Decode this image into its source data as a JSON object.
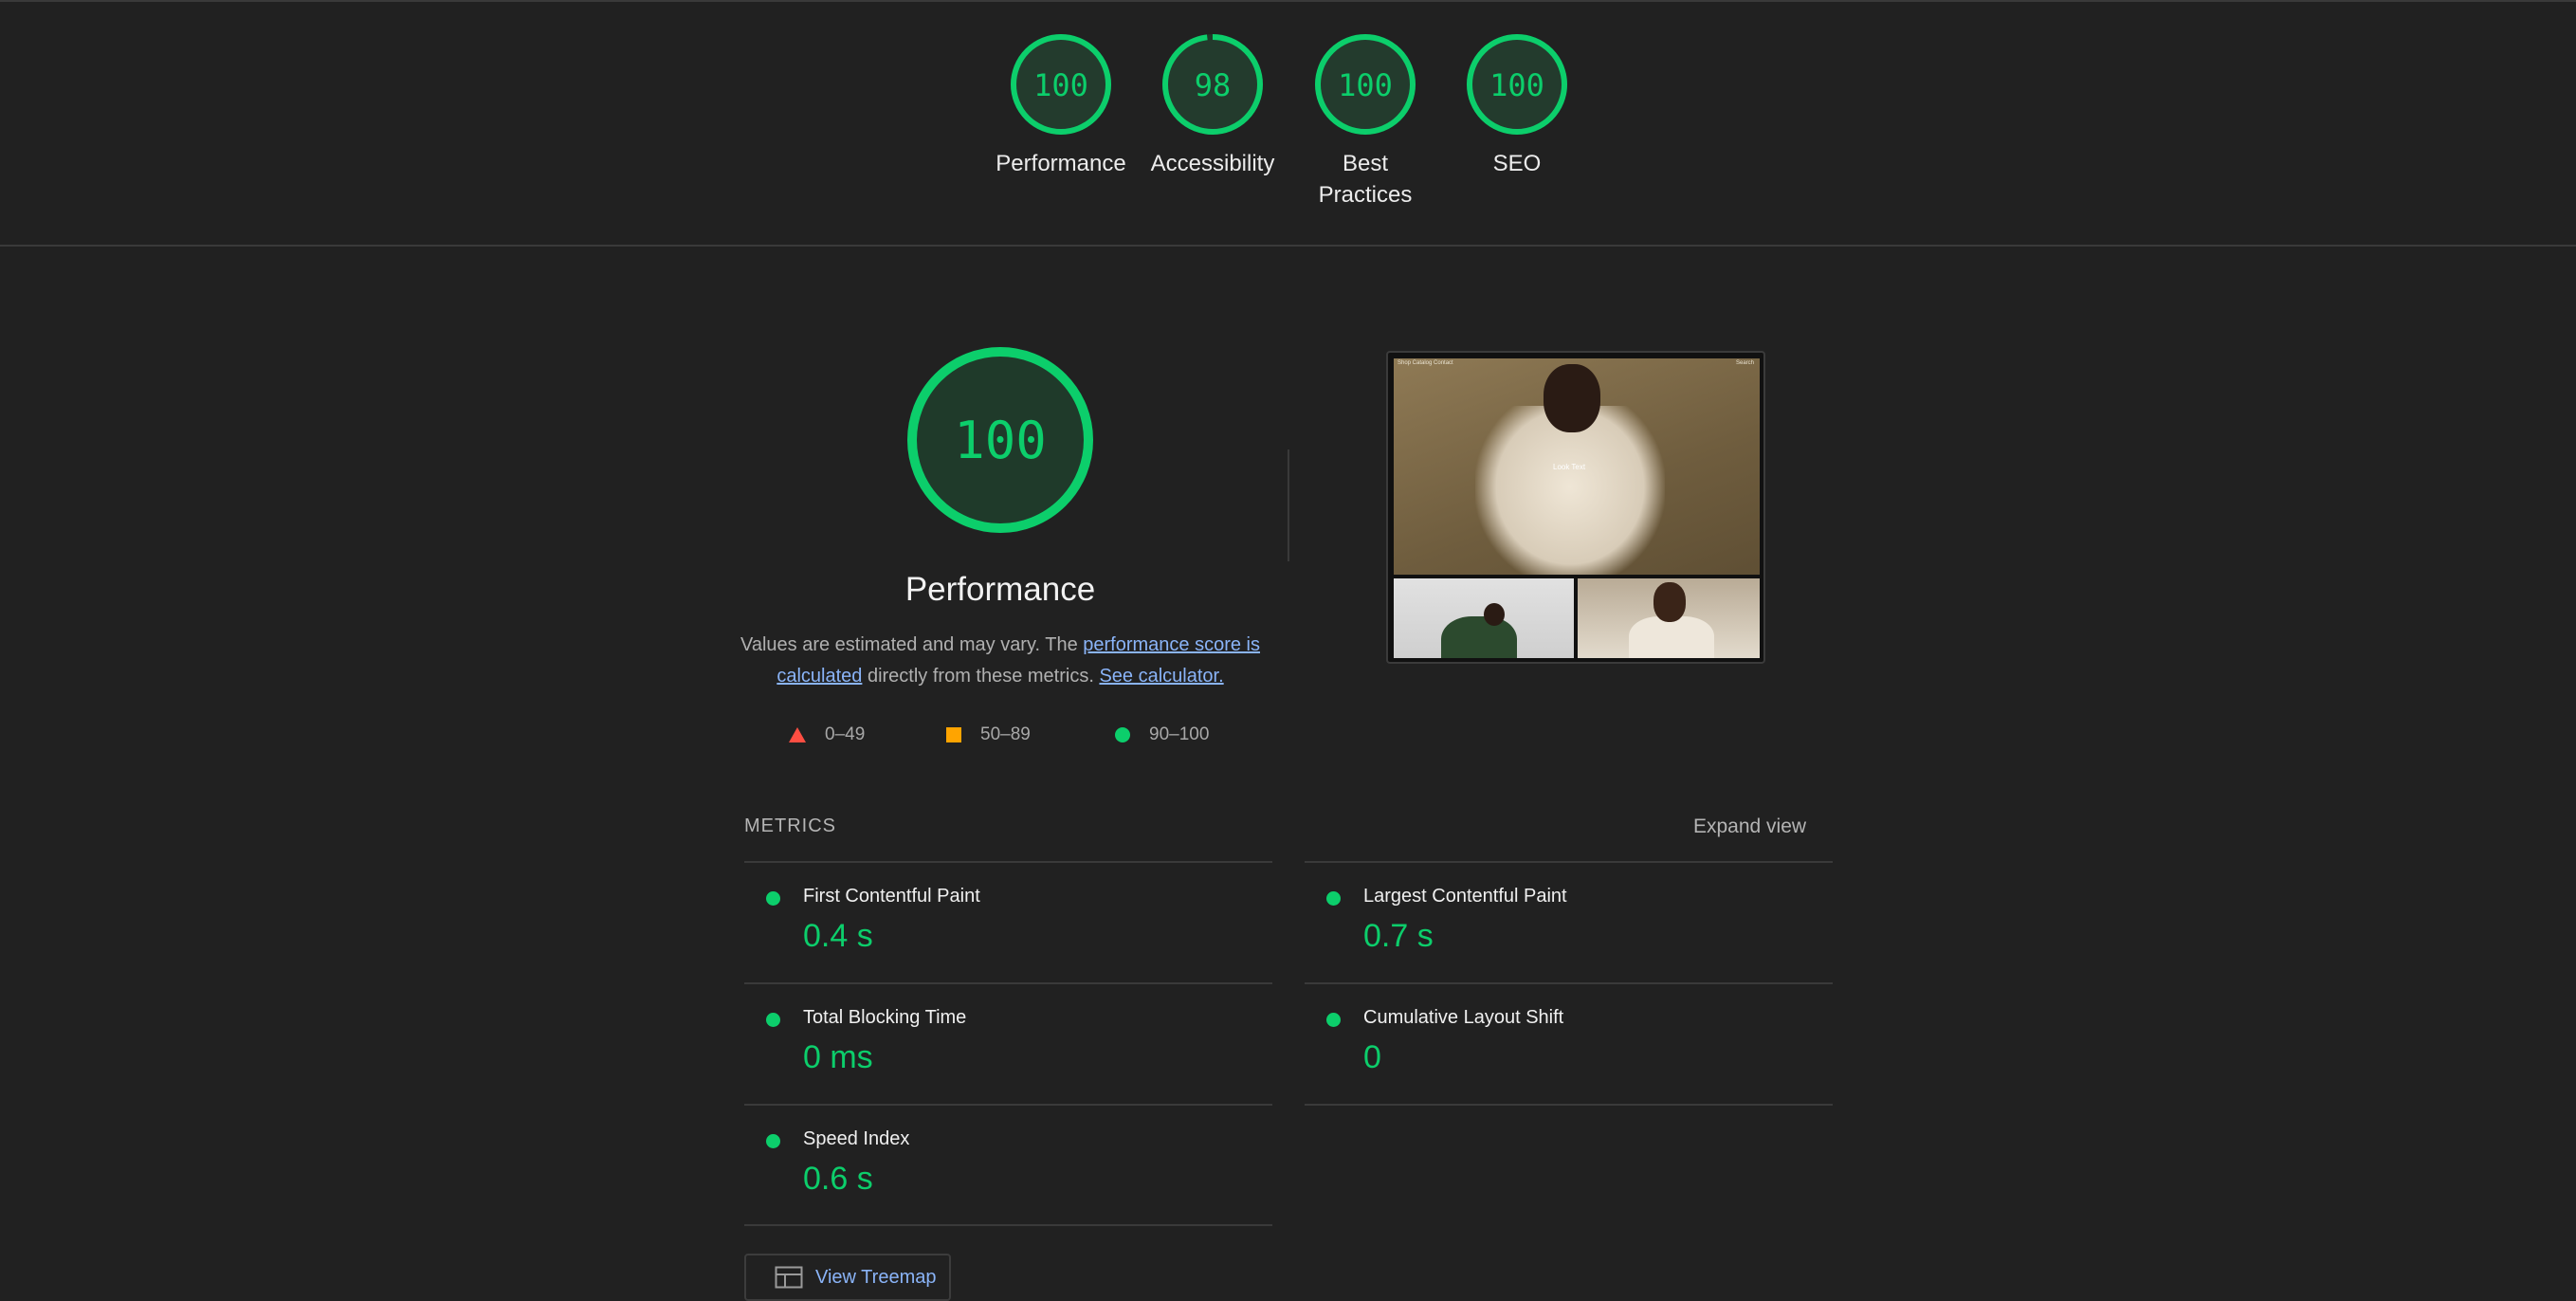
{
  "header_gauges": [
    {
      "label": "Performance",
      "score": "100",
      "fraction": 1.0
    },
    {
      "label": "Accessibility",
      "score": "98",
      "fraction": 0.98
    },
    {
      "label_line1": "Best",
      "label_line2": "Practices",
      "score": "100",
      "fraction": 1.0
    },
    {
      "label": "SEO",
      "score": "100",
      "fraction": 1.0
    }
  ],
  "performance": {
    "score": "100",
    "fraction": 1.0,
    "title": "Performance",
    "desc_prefix": "Values are estimated and may vary. The ",
    "desc_link": "performance score is calculated",
    "desc_middle": " directly from these metrics. ",
    "desc_link2": "See calculator.",
    "legend": [
      {
        "range": "0–49",
        "color": "#ff4e42",
        "icon": "triangle-icon"
      },
      {
        "range": "50–89",
        "color": "#ffa400",
        "icon": "square-icon"
      },
      {
        "range": "90–100",
        "color": "#0cce6b",
        "icon": "circle-icon"
      }
    ]
  },
  "thumbnail": {
    "nav_left": "Shop  Catalog  Contact",
    "nav_right": "Search",
    "hero_text": "Look Text"
  },
  "metrics": {
    "header": "METRICS",
    "expand_label": "Expand view",
    "items": [
      {
        "title": "First Contentful Paint",
        "value": "0.4 s"
      },
      {
        "title": "Largest Contentful Paint",
        "value": "0.7 s"
      },
      {
        "title": "Total Blocking Time",
        "value": "0 ms"
      },
      {
        "title": "Cumulative Layout Shift",
        "value": "0"
      },
      {
        "title": "Speed Index",
        "value": "0.6 s"
      }
    ]
  },
  "treemap": {
    "label": "View Treemap"
  },
  "colors": {
    "pass": "#0cce6b",
    "average": "#ffa400",
    "fail": "#ff4e42",
    "link": "#8ab4f8",
    "background": "#212121"
  }
}
